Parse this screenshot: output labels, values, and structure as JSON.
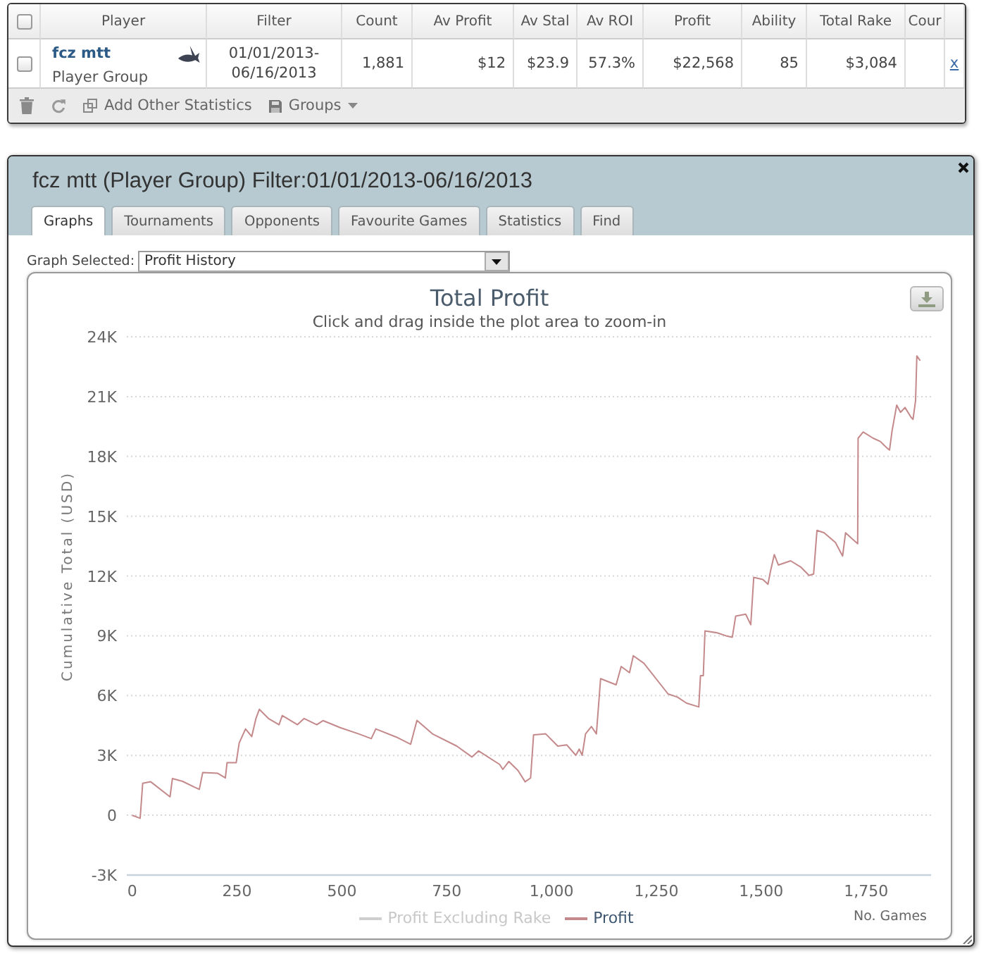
{
  "stats_table": {
    "select_all": {
      "checked": false
    },
    "columns": [
      "Player",
      "Filter",
      "Count",
      "Av Profit",
      "Av Stal",
      "Av ROI",
      "Profit",
      "Ability",
      "Total Rake",
      "Cour"
    ],
    "rows": [
      {
        "checked": false,
        "player": "fcz mtt",
        "player_type": "Player Group",
        "filter": "01/01/2013-06/16/2013",
        "values": [
          "1,881",
          "$12",
          "$23.9",
          "57.3%",
          "$22,568",
          "85",
          "$3,084"
        ],
        "link": "x"
      }
    ]
  },
  "toolbar": {
    "actions": [
      {
        "kind": "delete"
      },
      {
        "kind": "refresh"
      },
      {
        "kind": "add",
        "label": "Add Other Statistics"
      },
      {
        "kind": "groups",
        "label": "Groups"
      }
    ]
  },
  "player_window": {
    "title": "fcz mtt (Player Group) Filter:01/01/2013-06/16/2013",
    "tabs": [
      {
        "label": "Graphs",
        "selected": true
      },
      {
        "label": "Tournaments",
        "selected": false
      },
      {
        "label": "Opponents",
        "selected": false
      },
      {
        "label": "Favourite Games",
        "selected": false
      },
      {
        "label": "Statistics",
        "selected": false
      },
      {
        "label": "Find",
        "selected": false
      }
    ],
    "graph_select": {
      "label": "Graph Selected:",
      "value": "Profit History"
    },
    "chart": {
      "subtitle": "Click and drag inside the plot area to zoom-in",
      "legend": [
        {
          "hidden": true
        },
        {
          "hidden": false
        }
      ],
      "chart_data": {
        "type": "line",
        "title": "Total Profit",
        "xlabel": "No. Games",
        "ylabel": "Cumulative Total (USD)",
        "grid": "y",
        "x": [
          0,
          19,
          25,
          44,
          90,
          96,
          120,
          149,
          160,
          168,
          204,
          222,
          226,
          248,
          255,
          270,
          285,
          295,
          303,
          325,
          350,
          358,
          394,
          410,
          440,
          455,
          496,
          540,
          570,
          581,
          630,
          664,
          679,
          716,
          774,
          810,
          826,
          876,
          884,
          898,
          920,
          937,
          950,
          957,
          986,
          1015,
          1036,
          1058,
          1066,
          1073,
          1081,
          1095,
          1107,
          1117,
          1154,
          1166,
          1186,
          1195,
          1220,
          1278,
          1300,
          1322,
          1351,
          1355,
          1362,
          1366,
          1395,
          1416,
          1431,
          1439,
          1463,
          1475,
          1482,
          1504,
          1516,
          1522,
          1531,
          1541,
          1570,
          1595,
          1614,
          1625,
          1633,
          1650,
          1677,
          1694,
          1701,
          1711,
          1730,
          1731,
          1743,
          1767,
          1784,
          1793,
          1801,
          1806,
          1812,
          1823,
          1832,
          1843,
          1857,
          1862,
          1868,
          1871,
          1879
        ],
        "series": [
          {
            "name": "Profit Excluding Rake",
            "values": [
              null,
              null,
              null,
              null,
              null,
              null,
              null,
              null,
              null,
              null,
              null,
              null,
              null,
              null,
              null,
              null,
              null,
              null,
              null,
              null,
              null,
              null,
              null,
              null,
              null,
              null,
              null,
              null,
              null,
              null,
              null,
              null,
              null,
              null,
              null,
              null,
              null,
              null,
              null,
              null,
              null,
              null,
              null,
              null,
              null,
              null,
              null,
              null,
              null,
              null,
              null,
              null,
              null,
              null,
              null,
              null,
              null,
              null,
              null,
              null,
              null,
              null,
              null,
              null,
              null,
              null,
              null,
              null,
              null,
              null,
              null,
              null,
              null,
              null,
              null,
              null,
              null,
              null,
              null,
              null,
              null,
              null,
              null,
              null,
              null,
              null,
              null,
              null,
              null,
              null,
              null,
              null,
              null,
              null,
              null,
              null,
              null,
              null,
              null,
              null,
              null,
              null,
              null,
              null,
              null
            ]
          },
          {
            "name": "Profit",
            "color": "#c4898b",
            "values": [
              0,
              -150,
              1600,
              1680,
              920,
              1840,
              1700,
              1400,
              1300,
              2140,
              2100,
              1870,
              2640,
              2640,
              3620,
              4330,
              3950,
              4850,
              5310,
              4850,
              4540,
              5000,
              4540,
              4850,
              4540,
              4750,
              4390,
              4080,
              3840,
              4330,
              3920,
              3560,
              4760,
              4080,
              3470,
              2920,
              3230,
              2550,
              2300,
              2700,
              2240,
              1680,
              1870,
              4030,
              4080,
              3470,
              3530,
              3010,
              3320,
              3010,
              4080,
              4450,
              4080,
              6850,
              6540,
              7460,
              7150,
              8000,
              7620,
              6080,
              5930,
              5620,
              5430,
              7000,
              7000,
              9250,
              9150,
              9000,
              8930,
              9990,
              10080,
              9560,
              11930,
              11830,
              11590,
              12240,
              13070,
              12550,
              12760,
              12440,
              12030,
              12100,
              14290,
              14170,
              13680,
              13000,
              14170,
              13980,
              13620,
              18910,
              19220,
              18910,
              18750,
              18560,
              18400,
              18320,
              19270,
              20570,
              20210,
              20450,
              19970,
              19860,
              20800,
              23040,
              22800
            ]
          }
        ],
        "xlim": [
          -13,
          1905
        ],
        "ylim": [
          -3000,
          24000
        ],
        "xticks": [
          0,
          250,
          500,
          750,
          {
            "value": 1000,
            "label": "1,000"
          },
          {
            "value": 1250,
            "label": "1,250"
          },
          {
            "value": 1500,
            "label": "1,500"
          },
          {
            "value": 1750,
            "label": "1,750"
          }
        ],
        "yticks": [
          {
            "value": -3000,
            "label": "-3K"
          },
          0,
          {
            "value": 3000,
            "label": "3K"
          },
          {
            "value": 6000,
            "label": "6K"
          },
          {
            "value": 9000,
            "label": "9K"
          },
          {
            "value": 12000,
            "label": "12K"
          },
          {
            "value": 15000,
            "label": "15K"
          },
          {
            "value": 18000,
            "label": "18K"
          },
          {
            "value": 21000,
            "label": "21K"
          },
          {
            "value": 24000,
            "label": "24K"
          }
        ]
      }
    }
  }
}
